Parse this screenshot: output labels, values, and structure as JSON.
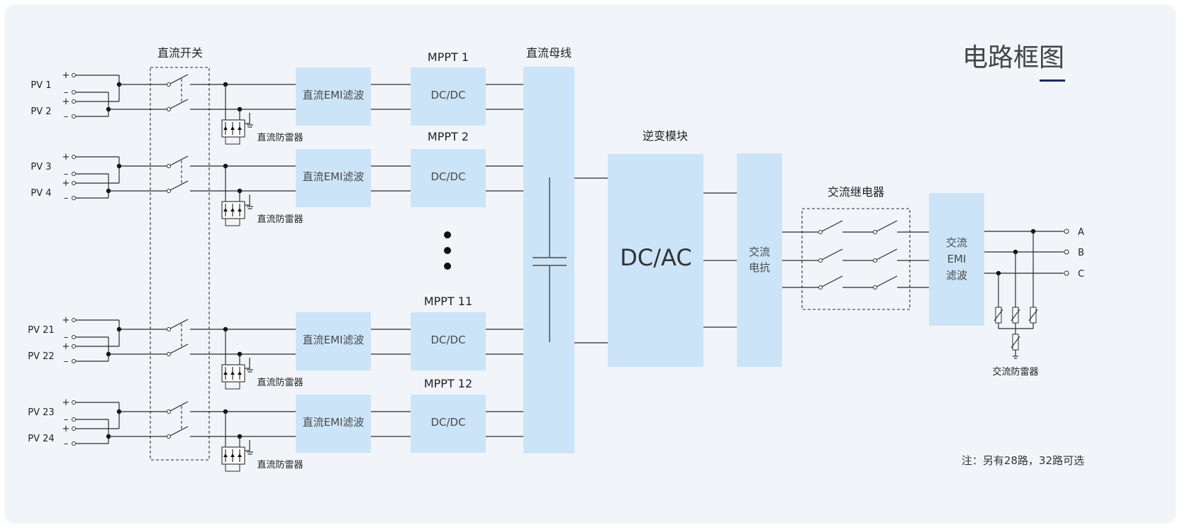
{
  "title": "电路框图",
  "dc_switch_label": "直流开关",
  "dc_bus_label": "直流母线",
  "inverter_label": "逆变模块",
  "inverter_block_text": "DC/AC",
  "ac_reactor_text": [
    "交流",
    "电抗"
  ],
  "ac_relay_label": "交流继电器",
  "ac_emi_text": [
    "交流",
    "EMI",
    "滤波"
  ],
  "ac_spd_label": "交流防雷器",
  "dc_spd_label": "直流防雷器",
  "emi_block_text": "直流EMI滤波",
  "dcdc_block_text": "DC/DC",
  "ellipsis": "⋮",
  "polarity_plus": "+",
  "polarity_minus": "–",
  "groups": [
    {
      "mppt": "MPPT 1",
      "pv_top": "PV 1",
      "pv_bottom": "PV 2"
    },
    {
      "mppt": "MPPT 2",
      "pv_top": "PV 3",
      "pv_bottom": "PV 4"
    },
    {
      "mppt": "MPPT 11",
      "pv_top": "PV 21",
      "pv_bottom": "PV 22"
    },
    {
      "mppt": "MPPT 12",
      "pv_top": "PV 23",
      "pv_bottom": "PV 24"
    }
  ],
  "phases": [
    "A",
    "B",
    "C"
  ],
  "note": "注：另有28路，32路可选",
  "colors": {
    "block": "#cce4f7",
    "panel": "#f1f5f9",
    "accent": "#1a2b5e",
    "line": "#2b2b2b"
  }
}
